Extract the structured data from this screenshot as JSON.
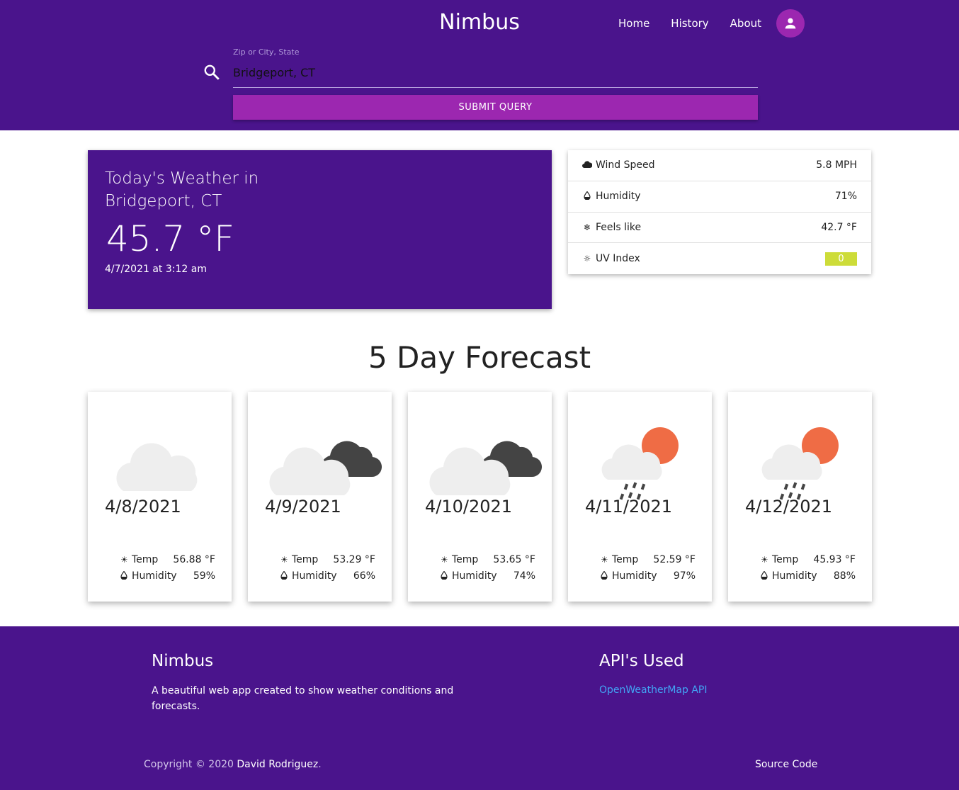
{
  "header": {
    "brand": "Nimbus",
    "nav": [
      "Home",
      "History",
      "About"
    ],
    "search_label": "Zip or City, State",
    "search_value": "Bridgeport, CT",
    "submit_label": "SUBMIT QUERY"
  },
  "today": {
    "title": "Today's Weather in Bridgeport, CT",
    "temp": "45.7 °F",
    "datetime": "4/7/2021 at 3:12 am"
  },
  "stats": [
    {
      "icon": "cloud-icon",
      "label": "Wind Speed",
      "value": "5.8 MPH"
    },
    {
      "icon": "droplet-icon",
      "label": "Humidity",
      "value": "71%"
    },
    {
      "icon": "snowflake-icon",
      "label": "Feels like",
      "value": "42.7 °F"
    },
    {
      "icon": "sun-icon",
      "label": "UV Index",
      "value": "0",
      "badge_color": "#cddc39"
    }
  ],
  "forecast": {
    "title": "5 Day Forecast",
    "days": [
      {
        "date": "4/8/2021",
        "icon": "cloud-icon",
        "temp_label": "Temp",
        "temp": "56.88 °F",
        "hum_label": "Humidity",
        "humidity": "59%"
      },
      {
        "date": "4/9/2021",
        "icon": "broken-clouds-icon",
        "temp_label": "Temp",
        "temp": "53.29 °F",
        "hum_label": "Humidity",
        "humidity": "66%"
      },
      {
        "date": "4/10/2021",
        "icon": "broken-clouds-icon",
        "temp_label": "Temp",
        "temp": "53.65 °F",
        "hum_label": "Humidity",
        "humidity": "74%"
      },
      {
        "date": "4/11/2021",
        "icon": "sun-rain-icon",
        "temp_label": "Temp",
        "temp": "52.59 °F",
        "hum_label": "Humidity",
        "humidity": "97%"
      },
      {
        "date": "4/12/2021",
        "icon": "sun-rain-icon",
        "temp_label": "Temp",
        "temp": "45.93 °F",
        "hum_label": "Humidity",
        "humidity": "88%"
      }
    ]
  },
  "footer": {
    "brand": "Nimbus",
    "description": "A beautiful web app created to show weather conditions and forecasts.",
    "api_title": "API's Used",
    "api_link": "OpenWeatherMap API",
    "copyright": "Copyright © 2020 ",
    "author": "David Rodriguez",
    "author_suffix": ".",
    "source_link": "Source Code"
  },
  "colors": {
    "primary": "#4a148c",
    "accent": "#9c27b0",
    "uv_badge": "#cddc39",
    "link": "#42a5f5"
  }
}
